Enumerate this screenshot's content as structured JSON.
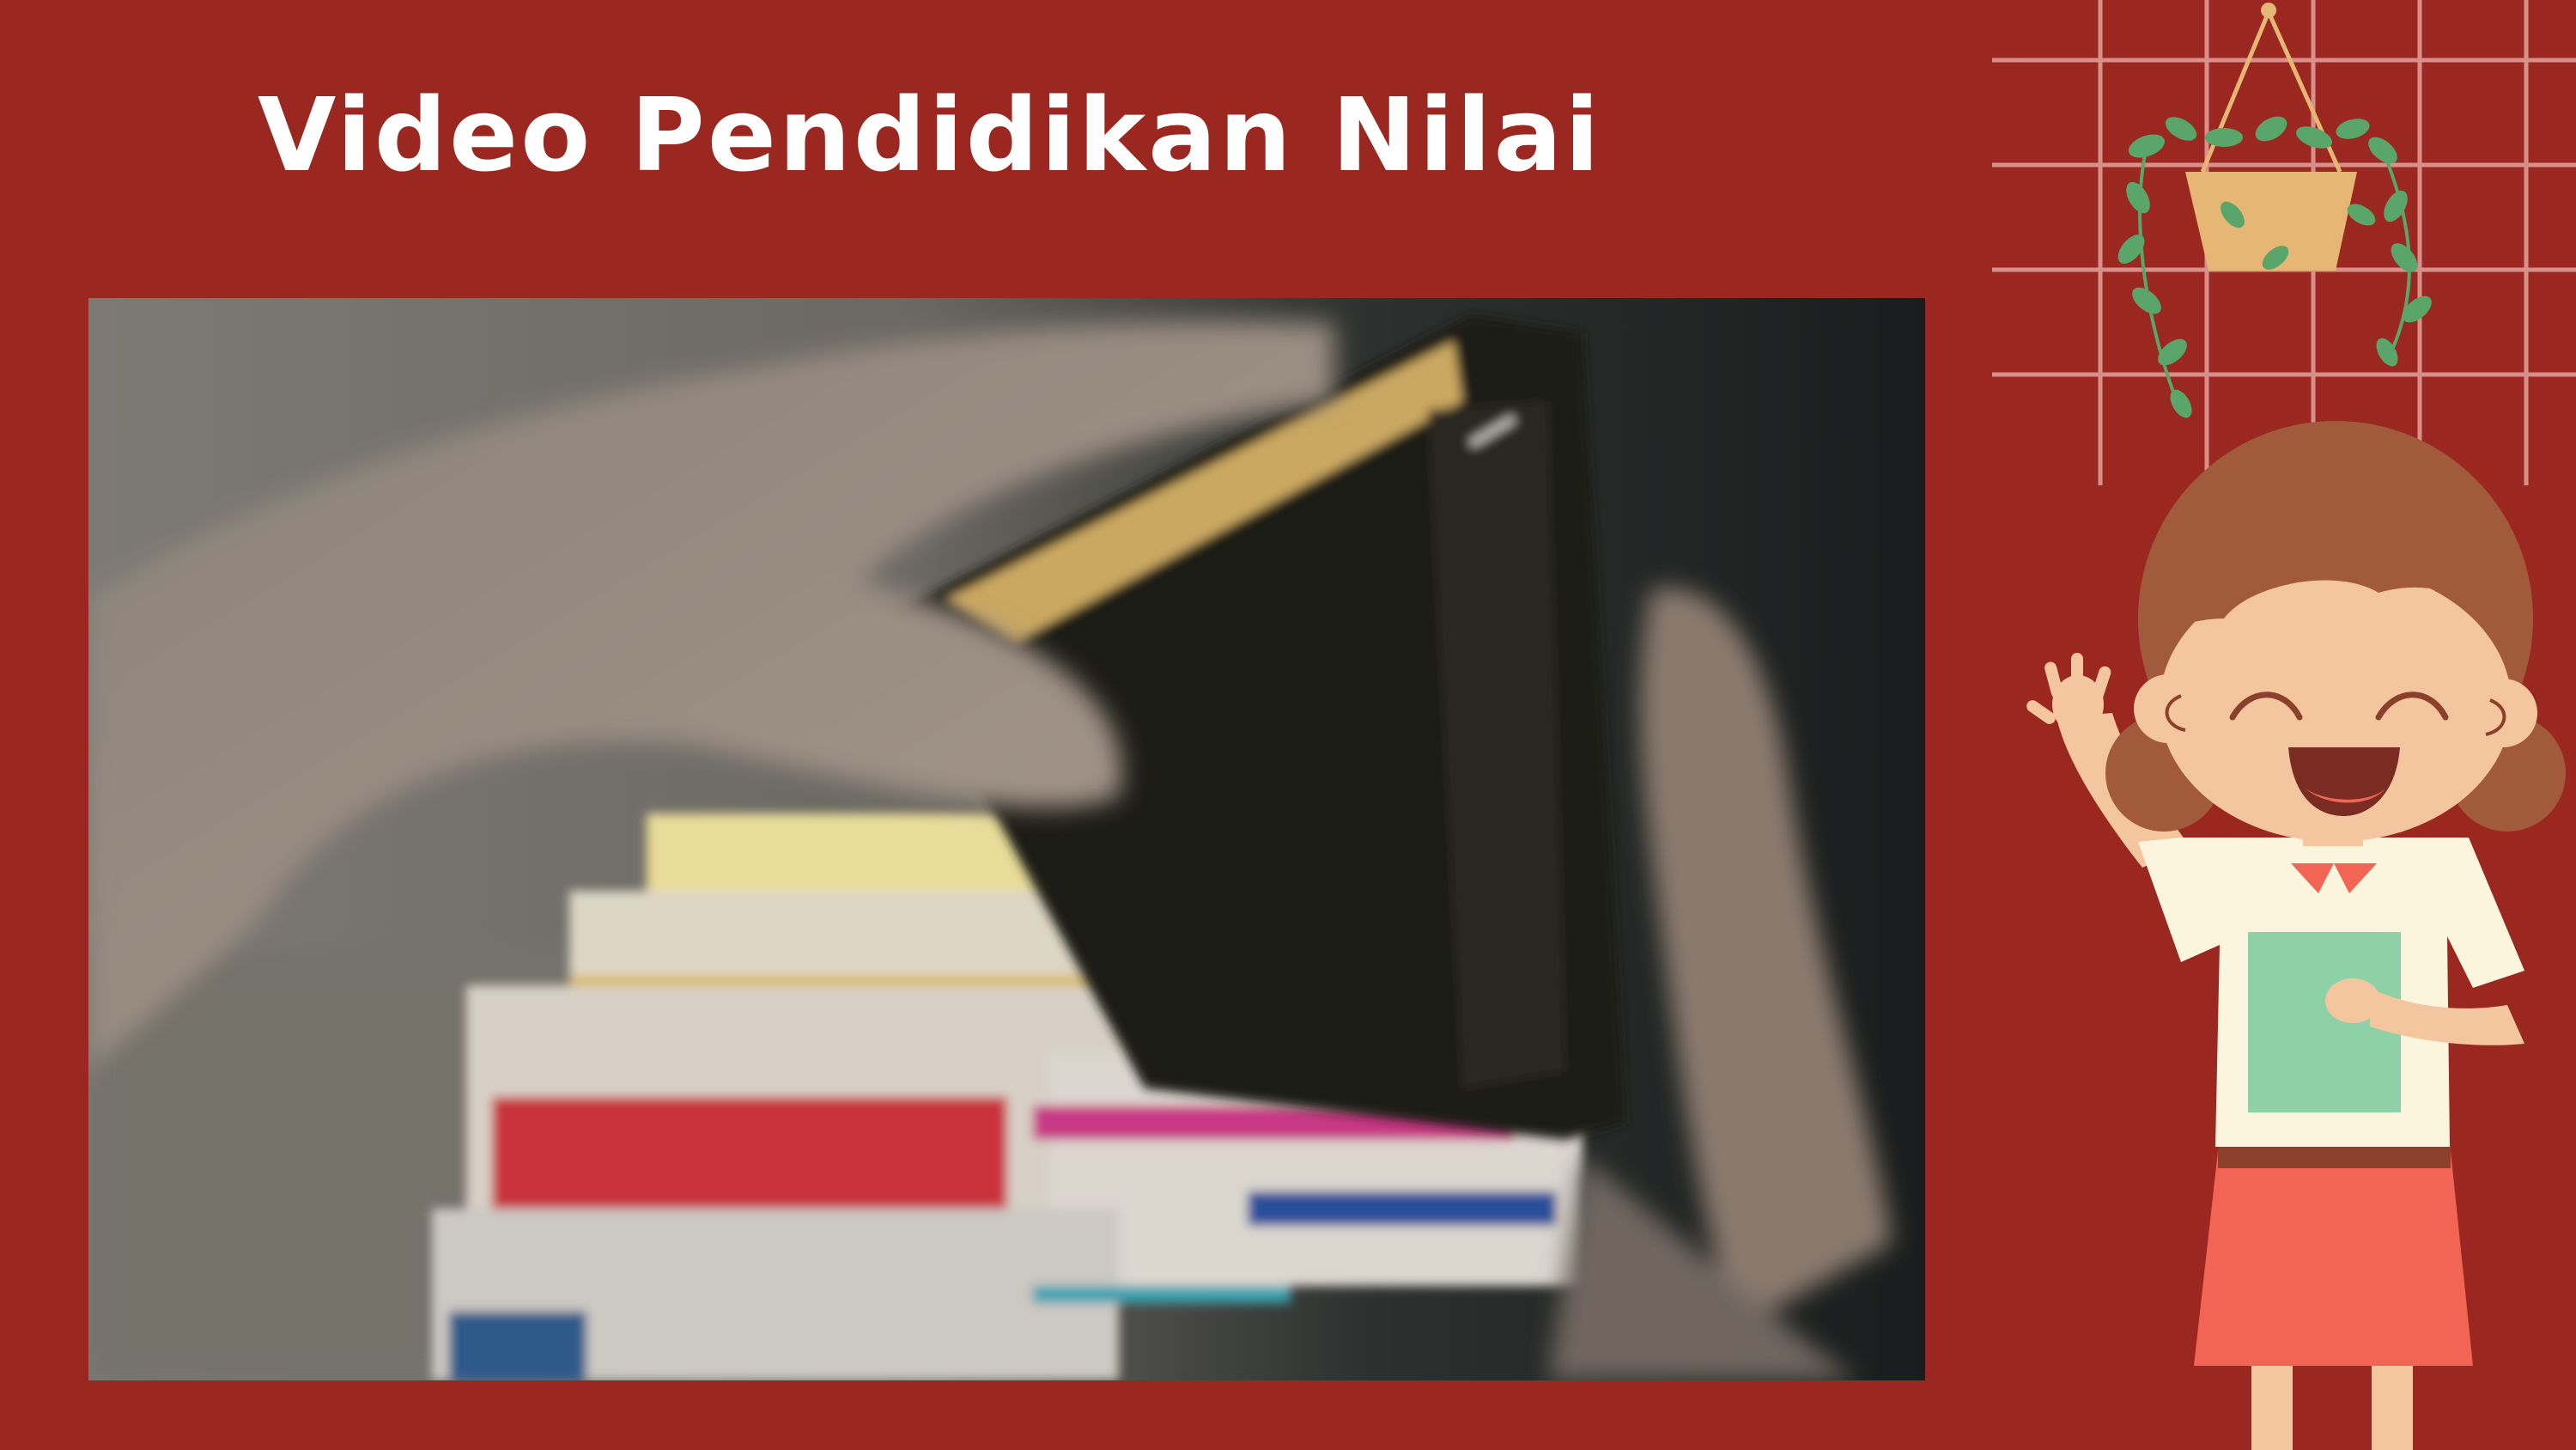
{
  "slide": {
    "title": "Video Pendidikan Nilai"
  },
  "video": {
    "icon": "video-frame-icon"
  },
  "decor": {
    "plant_icon": "hanging-plant-icon",
    "girl_icon": "cartoon-girl-icon",
    "grid_icon": "wall-grid-icon"
  },
  "colors": {
    "background": "#9b2820",
    "title": "#ffffff",
    "skirt": "#f26555",
    "hair": "#a15a3c",
    "shirt": "#fbf5dd",
    "pocket": "#8fd1a6",
    "pot": "#e6b774",
    "leaves": "#5aa56a"
  }
}
